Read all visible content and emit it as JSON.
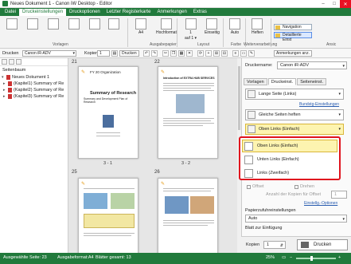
{
  "window": {
    "title": "Neues Dokument 1 - Canon iW Desktop - Editor",
    "min": "–",
    "max": "□",
    "close": "✕"
  },
  "menu": [
    "Datei",
    "Druckeinstellungen",
    "Druckoptionen",
    "Letzter Registerkarte",
    "Anmerkungen",
    "Extras"
  ],
  "ribbon": {
    "buttons": [
      "A4",
      "Hochformat",
      "1",
      "Einseitig",
      "Auto",
      "Heften"
    ],
    "button_subs": [
      "",
      "",
      "auf 1 ▾",
      "",
      "",
      ""
    ],
    "groups": [
      "Vorlagen",
      "Ausgabepapier",
      "Layout",
      "Farbe",
      "Weiterverarbeitung",
      "Ansic"
    ],
    "nav": [
      "Navigation",
      "Detaillierte Einst"
    ]
  },
  "toolbar": {
    "printer_label": "Drucken",
    "printer_value": "Canon iR-ADV",
    "copies_label": "Kopien",
    "copies_value": "1",
    "print_button": "Drucken",
    "annotations_button": "Anmerkungen anz."
  },
  "left": {
    "title": "Seitenbaum",
    "items": [
      "Neues Dokument 1",
      "(Kapitel1) Summary of Re",
      "(Kapitel2) Summary of Re",
      "(Kapitel3) Summary of Re"
    ]
  },
  "pages": [
    {
      "num": "21",
      "label": "3 - 1",
      "title": "Summary of Research",
      "head": "FY 20 Organization",
      "sub": "Summary and Development Plan of Research"
    },
    {
      "num": "22",
      "label": "3 - 2",
      "title": "",
      "head": "Introduction of EXTRA HUB SERVICES",
      "sub": ""
    },
    {
      "num": "25",
      "label": "",
      "title": "",
      "head": "",
      "sub": ""
    },
    {
      "num": "26",
      "label": "",
      "title": "",
      "head": "",
      "sub": ""
    }
  ],
  "right": {
    "printer_label": "Druckername:",
    "printer_value": "Canon iR-ADV",
    "tabs": [
      "Vorlagen",
      "Druckeinst.",
      "Seiteneinst."
    ],
    "settings": [
      "Lange Seite (Links)",
      "Gleiche Seiten heften",
      "Oben Links (Einfach)"
    ],
    "bundles_link": "Bundstg-Einstellungen",
    "popup": [
      "Oben Links (Einfach)",
      "Unten Links (Einfach)",
      "Links (Zweifach)"
    ],
    "checks": [
      "Offset",
      "Drehen"
    ],
    "copies_note": "Anzahl der Kopien für Offset",
    "copies_note_value": "1",
    "settings_link": "Einstellg.-Optionen",
    "paper_label": "Papierzufuhreinstellungen",
    "paper_value": "Auto",
    "insert_label": "Blatt zur Einfügung",
    "copies_label": "Kopien",
    "copies_value": "1",
    "print_button": "Drucken"
  },
  "status": {
    "pages": "Ausgewählte Seite: 23",
    "format": "Ausgabeformat:A4",
    "sheets": "Blätter gesamt: 13",
    "zoom": "25%"
  }
}
